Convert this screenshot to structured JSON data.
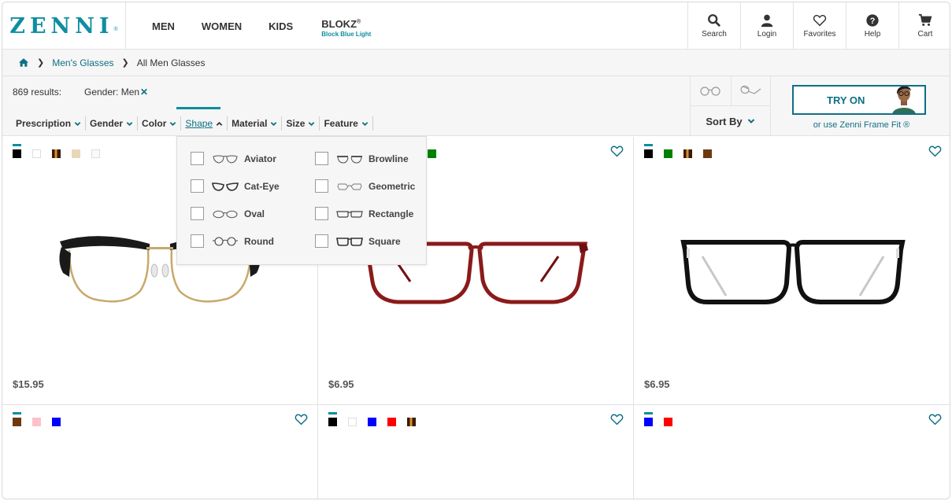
{
  "header": {
    "logo": "ZENNI",
    "logo_reg": "®",
    "nav": [
      {
        "label": "MEN"
      },
      {
        "label": "WOMEN"
      },
      {
        "label": "KIDS"
      }
    ],
    "blokz": {
      "label": "BLOKZ",
      "sup": "®",
      "sub": "Block Blue Light"
    },
    "icons": [
      {
        "label": "Search",
        "icon": "search-icon"
      },
      {
        "label": "Login",
        "icon": "user-icon"
      },
      {
        "label": "Favorites",
        "icon": "heart-icon"
      },
      {
        "label": "Help",
        "icon": "help-icon"
      },
      {
        "label": "Cart",
        "icon": "cart-icon"
      }
    ]
  },
  "breadcrumb": {
    "home_icon": "home-icon",
    "link": "Men's Glasses",
    "current": "All Men Glasses"
  },
  "filters": {
    "results": "869 results:",
    "gender_tag": "Gender: Men",
    "remove_symbol": "✕",
    "items": [
      "Prescription",
      "Gender",
      "Color",
      "Shape",
      "Material",
      "Size",
      "Feature"
    ],
    "active": "Shape",
    "sort_label": "Sort By",
    "try_on": "TRY ON",
    "frame_fit": "or use Zenni Frame Fit ®"
  },
  "shape_dropdown": {
    "options": [
      "Aviator",
      "Browline",
      "Cat-Eye",
      "Geometric",
      "Oval",
      "Rectangle",
      "Round",
      "Square"
    ]
  },
  "products": [
    {
      "price": "$15.95",
      "swatches": [
        "#000000",
        "#ffffff",
        "#8b4513",
        "#e8d8b8",
        "#ffffff"
      ],
      "frame_color": "#1a1a1a",
      "style": "browline"
    },
    {
      "price": "$6.95",
      "swatches": [
        "#008000"
      ],
      "frame_color": "#8b1a1a",
      "style": "rectangle"
    },
    {
      "price": "$6.95",
      "swatches": [
        "#000000",
        "#008000",
        "#8b4513",
        "#6b3a10"
      ],
      "frame_color": "#111111",
      "style": "square"
    },
    {
      "price": "",
      "swatches": [
        "#6b3a10",
        "#ffc0cb",
        "#0000ff"
      ]
    },
    {
      "price": "",
      "swatches": [
        "#000000",
        "#ffffff",
        "#0000ff",
        "#ff0000",
        "#8b4513"
      ]
    },
    {
      "price": "",
      "swatches": [
        "#0000ff",
        "#ff0000"
      ]
    }
  ],
  "colors": {
    "brand": "#0e8ea0",
    "link": "#0e6f85"
  }
}
